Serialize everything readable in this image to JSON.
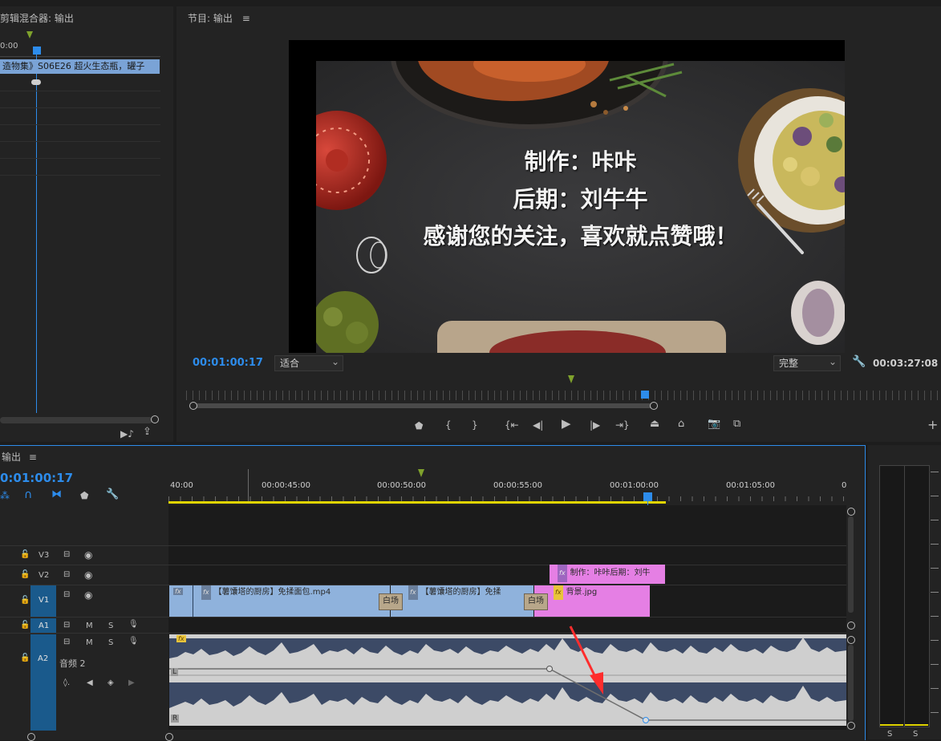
{
  "source_panel": {
    "title": "剪辑混合器: 输出",
    "timecode_left": "0:00",
    "clip_label": "造物集》S06E26 超火生态瓶，罐子"
  },
  "program_monitor": {
    "title": "节目: 输出",
    "current_time": "00:01:00:17",
    "zoom": "适合",
    "quality": "完整",
    "duration": "00:03:27:08",
    "subtitle_lines": [
      "制作：咔咔",
      "后期：刘牛牛",
      "感谢您的关注，喜欢就点赞哦！"
    ]
  },
  "timeline": {
    "title": "输出",
    "current_time": "0:01:00:17",
    "ruler_labels": [
      "40:00",
      "00:00:45:00",
      "00:00:50:00",
      "00:00:55:00",
      "00:01:00:00",
      "00:01:05:00",
      "0"
    ],
    "tracks": {
      "v3": "V3",
      "v2": "V2",
      "v1": "V1",
      "a1": "A1",
      "a2": "A2",
      "a2_name": "音频 2",
      "m": "M",
      "s": "S"
    },
    "clips": {
      "v1_clip1": "【薯馕塔的厨房】免揉面包.mp4",
      "v1_clip2": "【薯馕塔的厨房】免揉",
      "transition1": "白场",
      "transition2": "白场",
      "background": "背景.jpg",
      "v2_title": "制作：咔咔后期：刘牛",
      "fx": "fx",
      "channel_l": "L",
      "channel_r": "R"
    }
  },
  "meter": {
    "s1": "S",
    "s2": "S"
  },
  "colors": {
    "accent_blue": "#2d8ceb",
    "clip_video": "#8fb2dc",
    "clip_pink": "#e57fe4",
    "audio_wave_bg": "#3c4a66",
    "work_area": "#e0d400"
  }
}
